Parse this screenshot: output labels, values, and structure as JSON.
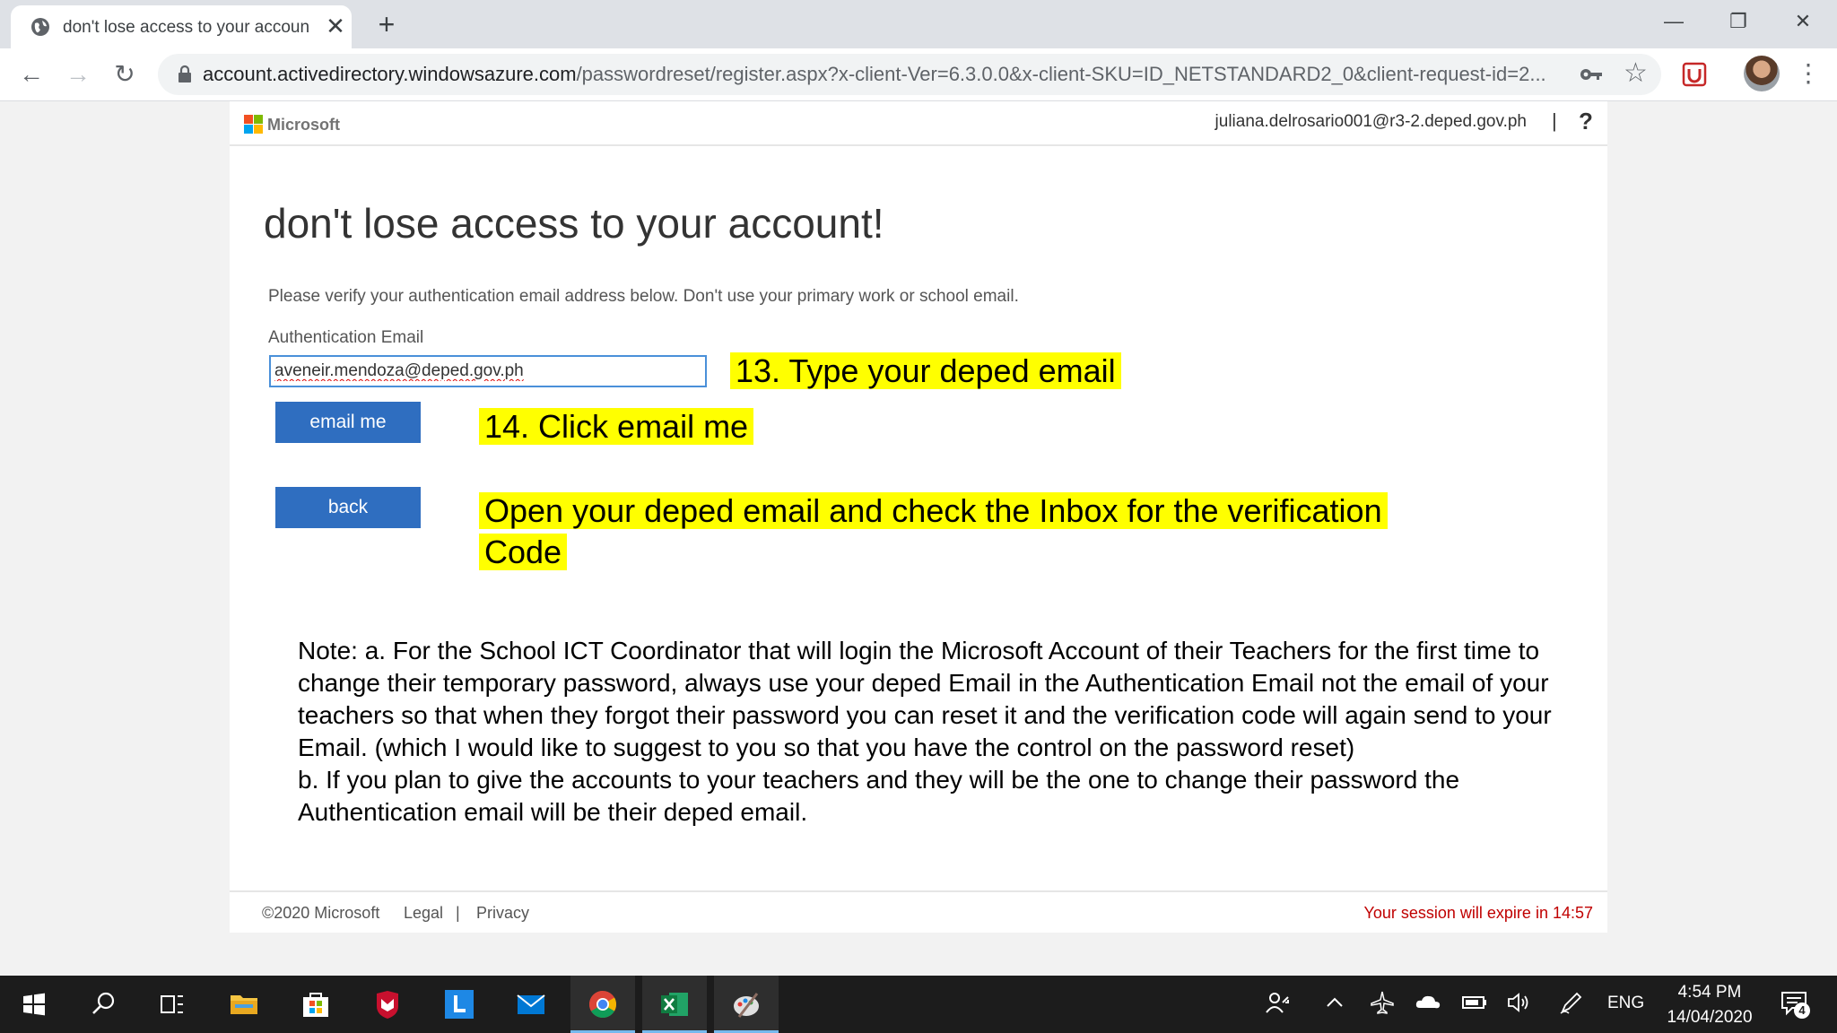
{
  "browser": {
    "tab_title": "don't lose access to your accoun",
    "tab_close": "✕",
    "new_tab": "+",
    "url_host": "account.activedirectory.windowsazure.com",
    "url_path": "/passwordreset/register.aspx?x-client-Ver=6.3.0.0&x-client-SKU=ID_NETSTANDARD2_0&client-request-id=2...",
    "back": "←",
    "forward": "→",
    "reload": "↻",
    "star": "☆",
    "menu": "⋮",
    "minimize": "—",
    "restore": "❐",
    "close": "✕"
  },
  "header": {
    "brand": "Microsoft",
    "user_email": "juliana.delrosario001@r3-2.deped.gov.ph",
    "separator": "|",
    "help": "?"
  },
  "page": {
    "heading": "don't lose access to your account!",
    "instructions": "Please verify your authentication email address below. Don't use your primary work or school email.",
    "auth_label": "Authentication Email",
    "auth_value": "aveneir.mendoza@deped.gov.ph",
    "email_me_label": "email me",
    "back_label": "back"
  },
  "annotations": {
    "step13": "13. Type your deped email",
    "step14": "14. Click email me",
    "open_inbox": "Open your deped email and check the Inbox for the verification Code",
    "highlight_color": "#ffff00"
  },
  "note": {
    "a": "Note: a. For the School ICT Coordinator that will login the Microsoft Account of their Teachers for the first time to change their temporary password, always use your deped Email in the Authentication Email not the email of your teachers so that when they forgot their password you can reset it and the verification code will again send to your Email. (which I would like to suggest to you so that you have the control on the password reset)",
    "b": "b. If you plan to give the accounts to your teachers and they will be the one to change their password the Authentication email will be their deped email."
  },
  "footer": {
    "copyright": "©2020 Microsoft",
    "legal": "Legal",
    "separator": "|",
    "privacy": "Privacy",
    "session": "Your session will expire in 14:57"
  },
  "taskbar": {
    "lang": "ENG",
    "time": "4:54 PM",
    "date": "14/04/2020",
    "notification_count": "4",
    "apps": [
      "start-icon",
      "search-icon",
      "task-view-icon",
      "file-explorer-icon",
      "store-icon",
      "mcafee-icon",
      "l-app-icon",
      "mail-icon",
      "chrome-icon",
      "excel-icon",
      "paint-icon"
    ]
  },
  "colors": {
    "button_blue": "#2f6ec0",
    "session_red": "#c00000",
    "input_border": "#4a90d9"
  }
}
